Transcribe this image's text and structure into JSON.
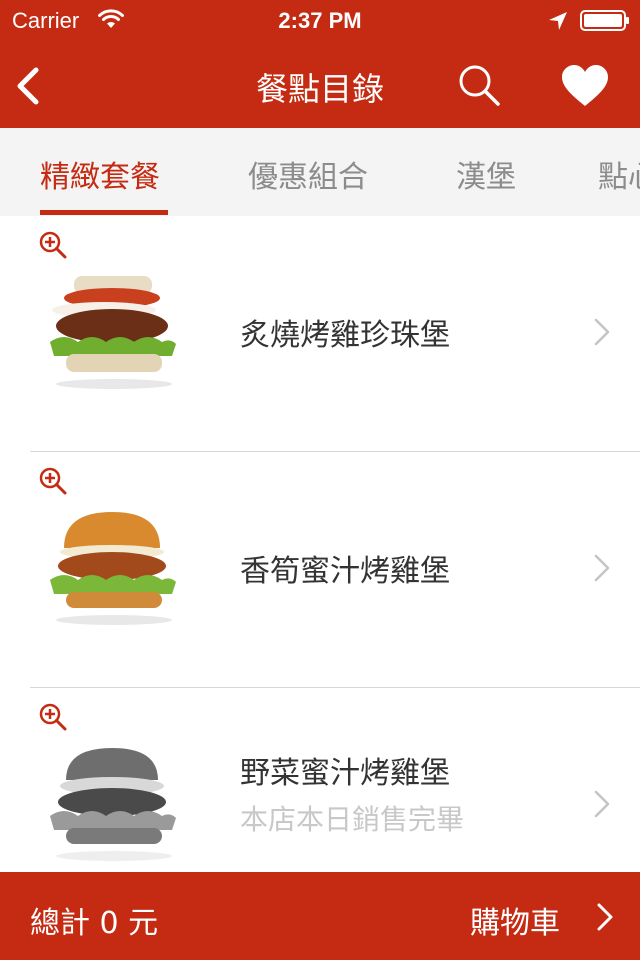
{
  "status_bar": {
    "carrier": "Carrier",
    "time": "2:37 PM",
    "icons": [
      "wifi-icon",
      "location-icon",
      "battery-icon"
    ]
  },
  "nav": {
    "title": "餐點目錄",
    "back_icon": "chevron-left-icon",
    "search_icon": "search-icon",
    "favorite_icon": "heart-icon"
  },
  "tabs": [
    {
      "label": "精緻套餐",
      "active": true
    },
    {
      "label": "優惠組合",
      "active": false
    },
    {
      "label": "漢堡",
      "active": false
    },
    {
      "label": "點心",
      "active": false
    }
  ],
  "menu_items": [
    {
      "name": "炙燒烤雞珍珠堡",
      "status": "",
      "available": true
    },
    {
      "name": "香筍蜜汁烤雞堡",
      "status": "",
      "available": true
    },
    {
      "name": "野菜蜜汁烤雞堡",
      "status": "本店本日銷售完畢",
      "available": false
    }
  ],
  "footer": {
    "total_label": "總計 0 元",
    "cart_label": "購物車"
  },
  "colors": {
    "brand": "#c42b12",
    "tab_background": "#f4f4f4",
    "inactive_tab": "#8c8c8c",
    "sold_out_text": "#c8c8c8"
  }
}
